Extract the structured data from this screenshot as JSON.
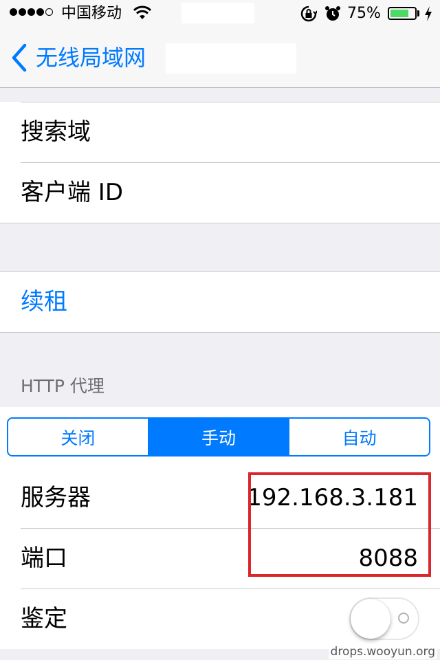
{
  "status_bar": {
    "carrier": "中国移动",
    "battery_percent": "75%",
    "battery_level": 0.75,
    "icons": [
      "signal-dots",
      "wifi-icon",
      "rotation-lock-icon",
      "alarm-icon",
      "battery-icon",
      "charging-icon"
    ]
  },
  "nav": {
    "back_label": "无线局域网"
  },
  "dhcp_group": {
    "rows": [
      {
        "label": "搜索域"
      },
      {
        "label": "客户端 ID"
      }
    ]
  },
  "renew": {
    "label": "续租"
  },
  "proxy": {
    "header": "HTTP 代理",
    "segments": [
      "关闭",
      "手动",
      "自动"
    ],
    "selected_segment": "手动",
    "server_label": "服务器",
    "server_value": "192.168.3.181",
    "port_label": "端口",
    "port_value": "8088",
    "auth_label": "鉴定",
    "auth_enabled": false
  },
  "colors": {
    "accent": "#007aff",
    "highlight": "#d9272e",
    "battery": "#4cd964",
    "background": "#efeff4"
  },
  "watermark": "drops.wooyun.org"
}
